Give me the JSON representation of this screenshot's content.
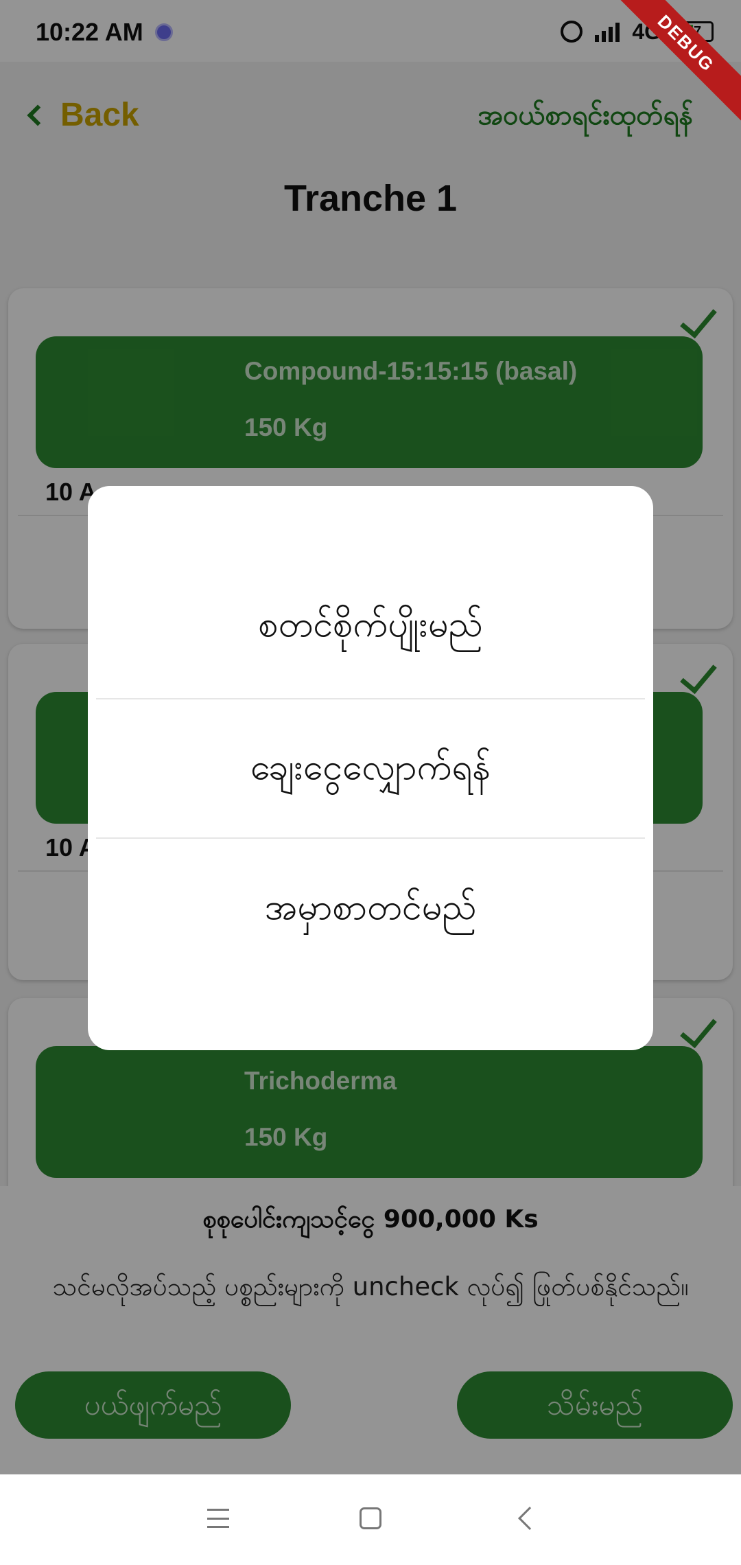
{
  "status_bar": {
    "time": "10:22 AM",
    "network": "4G",
    "battery": "47",
    "debug_banner": "DEBUG"
  },
  "header": {
    "back_label": "Back",
    "order_list_label": "အဝယ်စာရင်းထုတ်ရန်"
  },
  "page_title": "Tranche 1",
  "cards": [
    {
      "name": "Compound-15:15:15 (basal)",
      "qty": "150 Kg",
      "acre": "10 A"
    },
    {
      "name": "",
      "qty": "",
      "acre": "10 A"
    },
    {
      "name": "Trichoderma",
      "qty": "150 Kg",
      "acre": ""
    }
  ],
  "summary": {
    "total": "စုစုပေါင်းကျသင့်ငွေ 900,000 Ks",
    "note": "သင်မလိုအပ်သည့် ပစ္စည်းများကို uncheck လုပ်၍ ဖြုတ်ပစ်နိုင်သည်။",
    "cancel_label": "ပယ်ဖျက်မည်",
    "save_label": "သိမ်းမည်"
  },
  "dialog": {
    "options": [
      "စတင်စိုက်ပျိုးမည်",
      "ချေးငွေလျှောက်ရန်",
      "အမှာစာတင်မည်"
    ]
  },
  "nav_bar": {
    "icons": [
      "menu-icon",
      "home-icon",
      "back-icon"
    ]
  },
  "colors": {
    "primary_green": "#2e8b32",
    "back_yellow": "#c9a300",
    "scrim": "rgba(0,0,0,0.42)"
  }
}
